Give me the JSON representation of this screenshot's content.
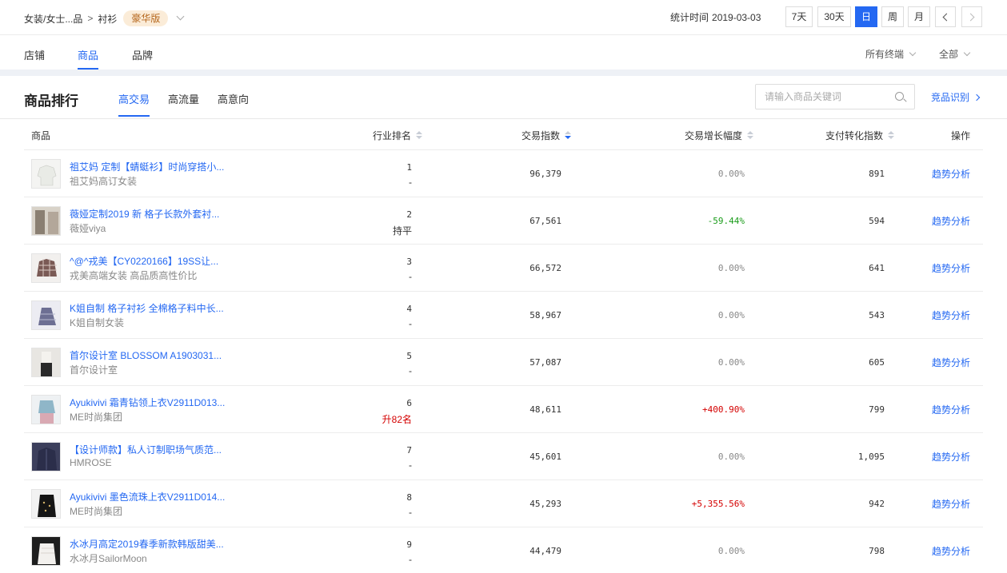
{
  "breadcrumb": {
    "category": "女装/女士...品",
    "separator": ">",
    "subcategory": "衬衫",
    "badge": "豪华版"
  },
  "header": {
    "stat_label": "统计时间",
    "stat_date": "2019-03-03",
    "periods": [
      "7天",
      "30天",
      "日",
      "周",
      "月"
    ],
    "active_period": "日"
  },
  "tabs": {
    "items": [
      "店铺",
      "商品",
      "品牌"
    ],
    "active": "商品"
  },
  "filters": {
    "terminal": "所有终端",
    "scope": "全部"
  },
  "ranking": {
    "title": "商品排行",
    "subtabs": [
      "高交易",
      "高流量",
      "高意向"
    ],
    "active_subtab": "高交易",
    "search_placeholder": "请输入商品关键词",
    "competitor_link": "竞品识别"
  },
  "table": {
    "columns": {
      "product": "商品",
      "rank": "行业排名",
      "trade_index": "交易指数",
      "growth": "交易增长幅度",
      "conversion": "支付转化指数",
      "action": "操作"
    },
    "rows": [
      {
        "name": "祖艾妈 定制【蜻蜓衫】时尚穿搭小...",
        "shop": "祖艾妈高订女装",
        "rank": "1",
        "change": "-",
        "trade": "96,379",
        "growth": "0.00%",
        "conv": "891",
        "action": "趋势分析"
      },
      {
        "name": "薇娅定制2019 新 格子长款外套衬...",
        "shop": "薇娅viya",
        "rank": "2",
        "change": "持平",
        "trade": "67,561",
        "growth": "-59.44%",
        "conv": "594",
        "action": "趋势分析"
      },
      {
        "name": "^@^戎美【CY0220166】19SS让...",
        "shop": "戎美高端女装 高品质高性价比",
        "rank": "3",
        "change": "-",
        "trade": "66,572",
        "growth": "0.00%",
        "conv": "641",
        "action": "趋势分析"
      },
      {
        "name": "K姐自制 格子衬衫 全棉格子料中长...",
        "shop": "K姐自制女装",
        "rank": "4",
        "change": "-",
        "trade": "58,967",
        "growth": "0.00%",
        "conv": "543",
        "action": "趋势分析"
      },
      {
        "name": "首尔设计室 BLOSSOM A1903031...",
        "shop": "首尔设计室",
        "rank": "5",
        "change": "-",
        "trade": "57,087",
        "growth": "0.00%",
        "conv": "605",
        "action": "趋势分析"
      },
      {
        "name": "Ayukivivi 霜青钻领上衣V2911D013...",
        "shop": "ME时尚集团",
        "rank": "6",
        "change": "升82名",
        "trade": "48,611",
        "growth": "+400.90%",
        "conv": "799",
        "action": "趋势分析"
      },
      {
        "name": "【设计师款】私人订制职场气质范...",
        "shop": "HMROSE",
        "rank": "7",
        "change": "-",
        "trade": "45,601",
        "growth": "0.00%",
        "conv": "1,095",
        "action": "趋势分析"
      },
      {
        "name": "Ayukivivi 墨色流珠上衣V2911D014...",
        "shop": "ME时尚集团",
        "rank": "8",
        "change": "-",
        "trade": "45,293",
        "growth": "+5,355.56%",
        "conv": "942",
        "action": "趋势分析"
      },
      {
        "name": "水冰月高定2019春季新款韩版甜美...",
        "shop": "水冰月SailorMoon",
        "rank": "9",
        "change": "-",
        "trade": "44,479",
        "growth": "0.00%",
        "conv": "798",
        "action": "趋势分析"
      }
    ]
  },
  "colors": {
    "accent": "#2468f2",
    "negative": "#1a9c1a",
    "positive": "#d40000",
    "badge_bg": "#fbecd8",
    "badge_fg": "#b5661c"
  }
}
